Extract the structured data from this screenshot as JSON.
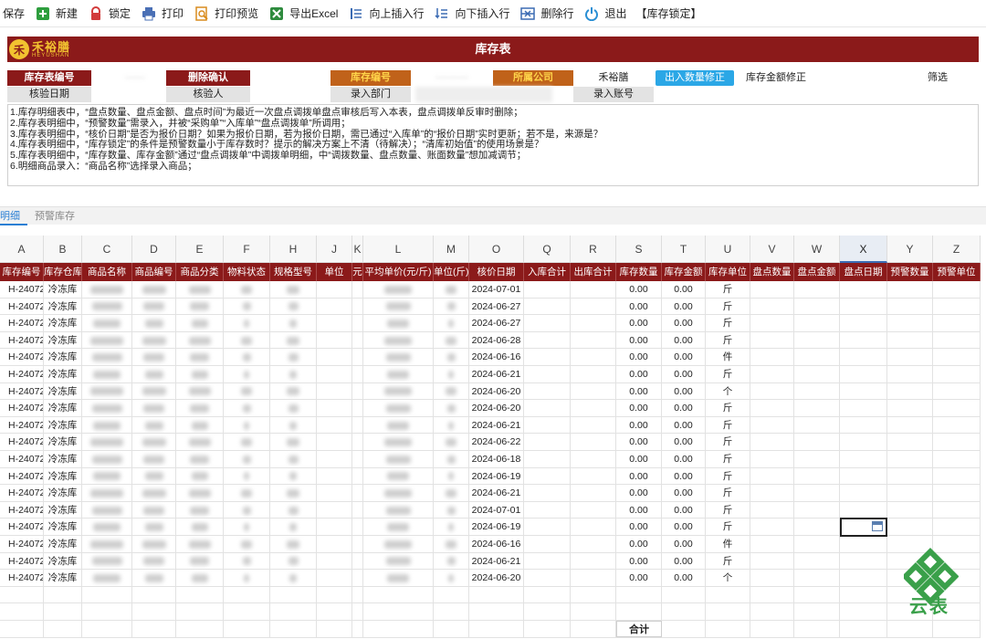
{
  "toolbar": {
    "items": [
      {
        "label": "保存",
        "icon": "save-icon",
        "color": "#333333"
      },
      {
        "label": "新建",
        "icon": "new-icon",
        "color": "#2e9e3e"
      },
      {
        "label": "锁定",
        "icon": "lock-icon",
        "color": "#d23b3b"
      },
      {
        "label": "打印",
        "icon": "printer-icon",
        "color": "#4a6fb5"
      },
      {
        "label": "打印预览",
        "icon": "print-preview-icon",
        "color": "#d98c1e"
      },
      {
        "label": "导出Excel",
        "icon": "excel-icon",
        "color": "#2e8b3e"
      },
      {
        "label": "向上插入行",
        "icon": "insert-row-above-icon",
        "color": "#3b6bb3"
      },
      {
        "label": "向下插入行",
        "icon": "insert-row-below-icon",
        "color": "#3b6bb3"
      },
      {
        "label": "删除行",
        "icon": "delete-row-icon",
        "color": "#3b6bb3"
      },
      {
        "label": "退出",
        "icon": "power-icon",
        "color": "#2a8fd4"
      }
    ],
    "lock_state": "【库存锁定】"
  },
  "header": {
    "logo_cn": "禾裕膳",
    "logo_en": "HEYUSHAN",
    "title": "库存表"
  },
  "form": {
    "stock_no_label": "库存表编号",
    "delete_confirm_label": "删除确认",
    "stock_code_label": "库存编号",
    "company_label": "所属公司",
    "company_value": "禾裕膳",
    "fix_qty_button": "出入数量修正",
    "fix_amount_label": "库存金额修正",
    "filter_label": "筛选",
    "check_date_label": "核验日期",
    "checker_label": "核验人",
    "entry_dept_label": "录入部门",
    "entry_account_label": "录入账号"
  },
  "notes": [
    "1.库存明细表中，“盘点数量、盘点金额、盘点时间”为最近一次盘点调拨单盘点审核后写入本表，盘点调拨单反审时删除；",
    "2.库存表明细中，“预警数量”需录入，并被“采购单”“入库单”“盘点调拨单”所调用；",
    "3.库存表明细中，“核价日期”是否为报价日期？如果为报价日期，若为报价日期，需已通过“入库单”的“报价日期”实时更新；若不是，来源是？",
    "4.库存表明细中，“库存锁定”的条件是预警数量小于库存数时？提示的解决方案上不清（待解决）；“清库初始值”的使用场景是？",
    "5.库存表明细中，“库存数量、库存金额”通过“盘点调拨单”中调拨单明细，中“调拨数量、盘点数量、账面数量”想加减调节；",
    "6.明细商品录入：“商品名称”选择录入商品；"
  ],
  "sheet_tabs": {
    "active": "明细",
    "inactive": "预警库存"
  },
  "grid": {
    "column_letters": [
      "A",
      "B",
      "C",
      "D",
      "E",
      "F",
      "H",
      "J",
      "K",
      "L",
      "M",
      "O",
      "Q",
      "R",
      "S",
      "T",
      "U",
      "V",
      "W",
      "X",
      "Y",
      "Z"
    ],
    "field_headers": [
      "库存编号",
      "库存仓库",
      "商品名称",
      "商品编号",
      "商品分类",
      "物料状态",
      "规格型号",
      "单位",
      "元",
      "平均单价(元/斤)",
      "单位(斤)",
      "核价日期",
      "入库合计",
      "出库合计",
      "库存数量",
      "库存金额",
      "库存单位",
      "盘点数量",
      "盘点金额",
      "盘点日期",
      "预警数量",
      "预警单位"
    ],
    "selected_column": "X",
    "rows": [
      {
        "id": "H-24072",
        "wh": "冷冻库",
        "date": "2024-07-01",
        "qty": "0.00",
        "amt": "0.00",
        "unit": "斤"
      },
      {
        "id": "H-24072",
        "wh": "冷冻库",
        "date": "2024-06-27",
        "qty": "0.00",
        "amt": "0.00",
        "unit": "斤"
      },
      {
        "id": "H-24072",
        "wh": "冷冻库",
        "date": "2024-06-27",
        "qty": "0.00",
        "amt": "0.00",
        "unit": "斤"
      },
      {
        "id": "H-24072",
        "wh": "冷冻库",
        "date": "2024-06-28",
        "qty": "0.00",
        "amt": "0.00",
        "unit": "斤"
      },
      {
        "id": "H-24072",
        "wh": "冷冻库",
        "date": "2024-06-16",
        "qty": "0.00",
        "amt": "0.00",
        "unit": "件"
      },
      {
        "id": "H-24072",
        "wh": "冷冻库",
        "date": "2024-06-21",
        "qty": "0.00",
        "amt": "0.00",
        "unit": "斤"
      },
      {
        "id": "H-24072",
        "wh": "冷冻库",
        "date": "2024-06-20",
        "qty": "0.00",
        "amt": "0.00",
        "unit": "个"
      },
      {
        "id": "H-24072",
        "wh": "冷冻库",
        "date": "2024-06-20",
        "qty": "0.00",
        "amt": "0.00",
        "unit": "斤"
      },
      {
        "id": "H-24072",
        "wh": "冷冻库",
        "date": "2024-06-21",
        "qty": "0.00",
        "amt": "0.00",
        "unit": "斤"
      },
      {
        "id": "H-24072",
        "wh": "冷冻库",
        "date": "2024-06-22",
        "qty": "0.00",
        "amt": "0.00",
        "unit": "斤"
      },
      {
        "id": "H-24072",
        "wh": "冷冻库",
        "date": "2024-06-18",
        "qty": "0.00",
        "amt": "0.00",
        "unit": "斤"
      },
      {
        "id": "H-24072",
        "wh": "冷冻库",
        "date": "2024-06-19",
        "qty": "0.00",
        "amt": "0.00",
        "unit": "斤"
      },
      {
        "id": "H-24072",
        "wh": "冷冻库",
        "date": "2024-06-21",
        "qty": "0.00",
        "amt": "0.00",
        "unit": "斤"
      },
      {
        "id": "H-24072",
        "wh": "冷冻库",
        "date": "2024-07-01",
        "qty": "0.00",
        "amt": "0.00",
        "unit": "斤"
      },
      {
        "id": "H-24072",
        "wh": "冷冻库",
        "date": "2024-06-19",
        "qty": "0.00",
        "amt": "0.00",
        "unit": "斤"
      },
      {
        "id": "H-24072",
        "wh": "冷冻库",
        "date": "2024-06-16",
        "qty": "0.00",
        "amt": "0.00",
        "unit": "件"
      },
      {
        "id": "H-24072",
        "wh": "冷冻库",
        "date": "2024-06-21",
        "qty": "0.00",
        "amt": "0.00",
        "unit": "斤"
      },
      {
        "id": "H-24072",
        "wh": "冷冻库",
        "date": "2024-06-20",
        "qty": "0.00",
        "amt": "0.00",
        "unit": "个"
      }
    ],
    "sum_label": "合计"
  },
  "watermark": {
    "text": "云表",
    "color": "#3aa04a"
  }
}
